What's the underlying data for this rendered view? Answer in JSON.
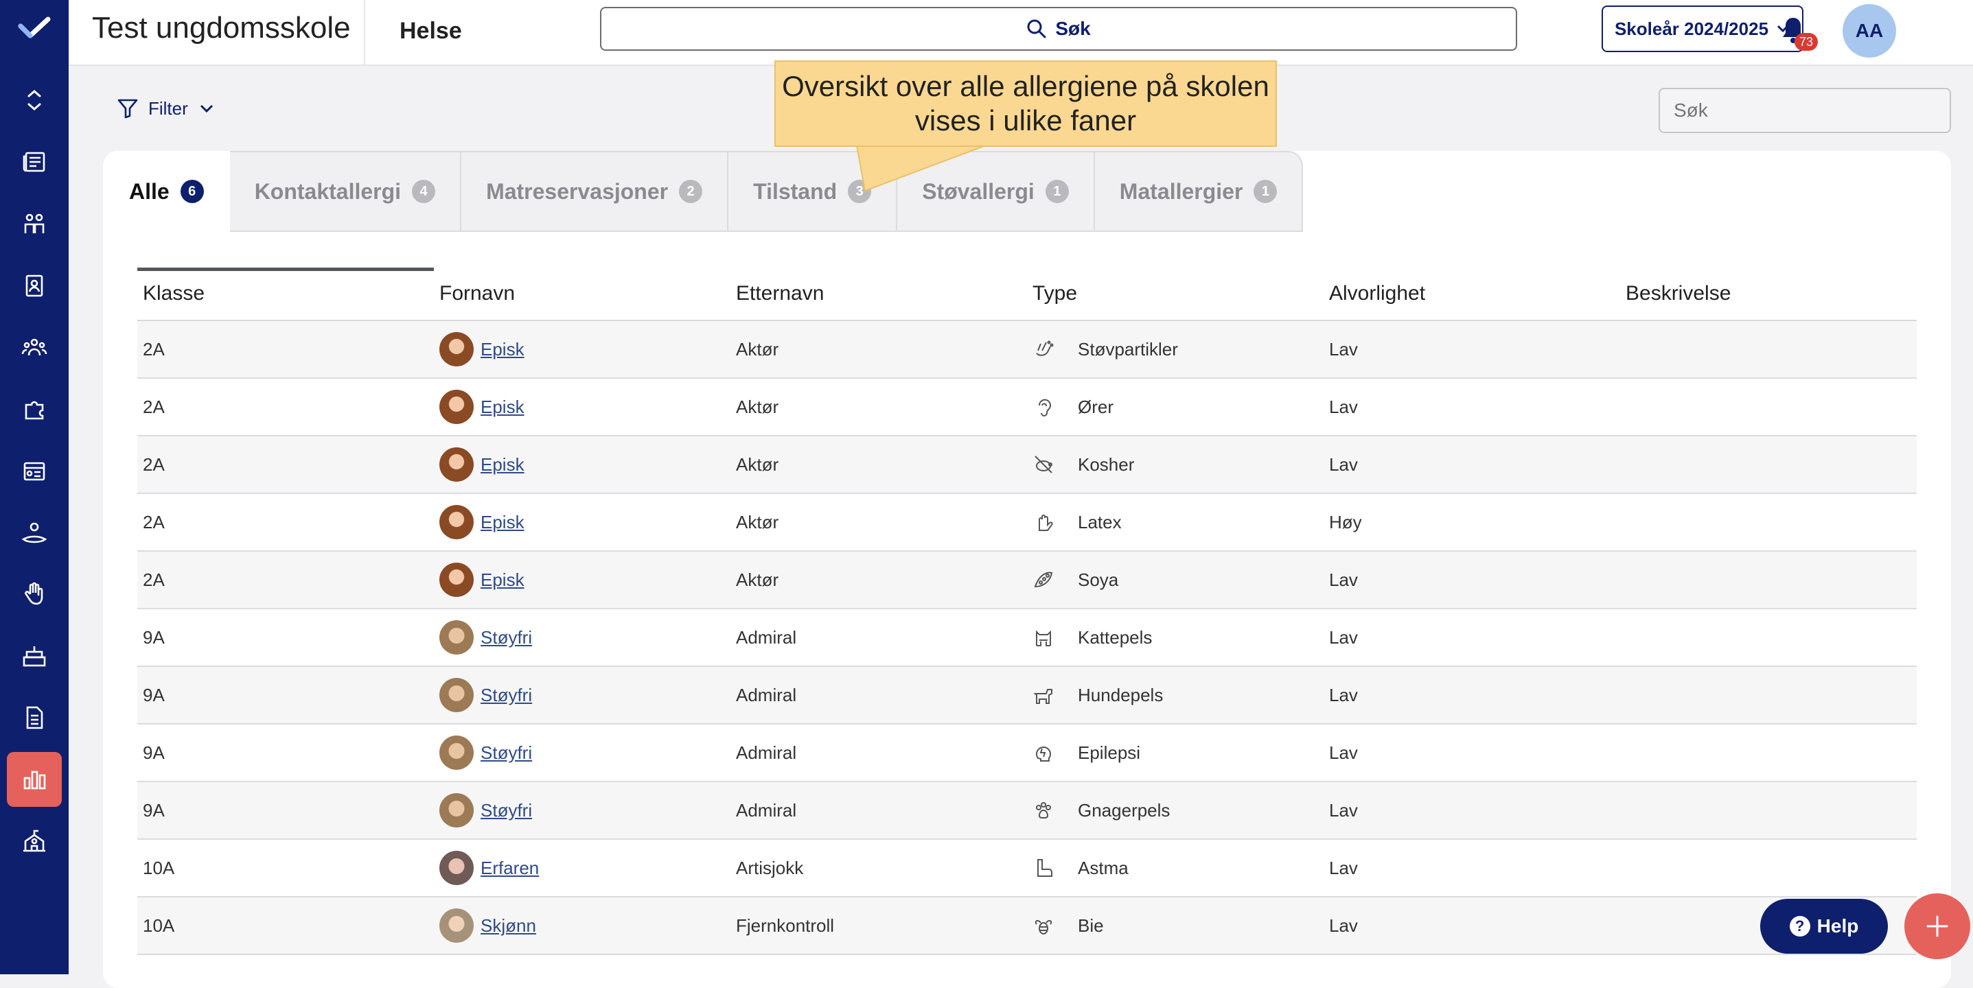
{
  "header": {
    "school_name": "Test ungdomsskole",
    "module": "Helse",
    "search_label": "Søk",
    "year_label": "Skoleår 2024/2025",
    "notifications_count": "73",
    "user_initials": "AA"
  },
  "filter": {
    "label": "Filter"
  },
  "local_search": {
    "placeholder": "Søk"
  },
  "callout": {
    "text": "Oversikt over alle allergiene på skolen vises i ulike faner"
  },
  "tabs": [
    {
      "label": "Alle",
      "count": "6"
    },
    {
      "label": "Kontaktallergi",
      "count": "4"
    },
    {
      "label": "Matreservasjoner",
      "count": "2"
    },
    {
      "label": "Tilstand",
      "count": "3"
    },
    {
      "label": "Støvallergi",
      "count": "1"
    },
    {
      "label": "Matallergier",
      "count": "1"
    }
  ],
  "table": {
    "columns": [
      "Klasse",
      "Fornavn",
      "Etternavn",
      "Type",
      "Alvorlighet",
      "Beskrivelse"
    ],
    "rows": [
      {
        "klasse": "2A",
        "fornavn": "Episk",
        "etternavn": "Aktør",
        "type": "Støvpartikler",
        "alvorlighet": "Lav",
        "beskrivelse": ""
      },
      {
        "klasse": "2A",
        "fornavn": "Episk",
        "etternavn": "Aktør",
        "type": "Ører",
        "alvorlighet": "Lav",
        "beskrivelse": ""
      },
      {
        "klasse": "2A",
        "fornavn": "Episk",
        "etternavn": "Aktør",
        "type": "Kosher",
        "alvorlighet": "Lav",
        "beskrivelse": ""
      },
      {
        "klasse": "2A",
        "fornavn": "Episk",
        "etternavn": "Aktør",
        "type": "Latex",
        "alvorlighet": "Høy",
        "beskrivelse": ""
      },
      {
        "klasse": "2A",
        "fornavn": "Episk",
        "etternavn": "Aktør",
        "type": "Soya",
        "alvorlighet": "Lav",
        "beskrivelse": ""
      },
      {
        "klasse": "9A",
        "fornavn": "Støyfri",
        "etternavn": "Admiral",
        "type": "Kattepels",
        "alvorlighet": "Lav",
        "beskrivelse": ""
      },
      {
        "klasse": "9A",
        "fornavn": "Støyfri",
        "etternavn": "Admiral",
        "type": "Hundepels",
        "alvorlighet": "Lav",
        "beskrivelse": ""
      },
      {
        "klasse": "9A",
        "fornavn": "Støyfri",
        "etternavn": "Admiral",
        "type": "Epilepsi",
        "alvorlighet": "Lav",
        "beskrivelse": ""
      },
      {
        "klasse": "9A",
        "fornavn": "Støyfri",
        "etternavn": "Admiral",
        "type": "Gnagerpels",
        "alvorlighet": "Lav",
        "beskrivelse": ""
      },
      {
        "klasse": "10A",
        "fornavn": "Erfaren",
        "etternavn": "Artisjokk",
        "type": "Astma",
        "alvorlighet": "Lav",
        "beskrivelse": ""
      },
      {
        "klasse": "10A",
        "fornavn": "Skjønn",
        "etternavn": "Fjernkontroll",
        "type": "Bie",
        "alvorlighet": "Lav",
        "beskrivelse": ""
      }
    ]
  },
  "help_button": {
    "label": "Help"
  },
  "colors": {
    "navy": "#0e1f6e",
    "accent": "#e4625b",
    "callout": "#fad891"
  }
}
